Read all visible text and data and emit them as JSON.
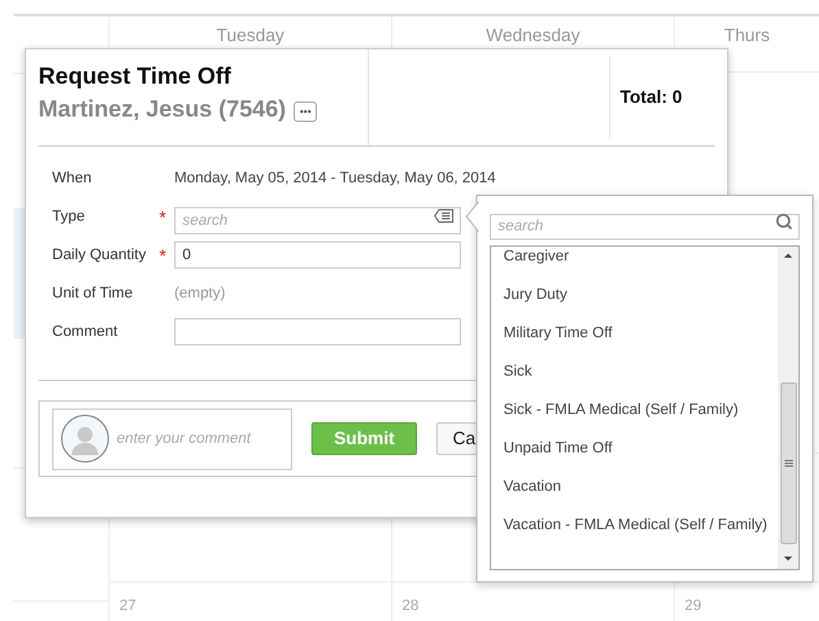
{
  "calendar": {
    "day_headers": [
      "Tuesday",
      "Wednesday",
      "Thurs"
    ],
    "date_numbers": [
      "27",
      "28",
      "29"
    ]
  },
  "dialog": {
    "title": "Request Time Off",
    "employee": "Martinez, Jesus (7546)",
    "more_button": "•••",
    "total": "Total: 0",
    "fields": [
      {
        "kind": "text",
        "label": "When",
        "required": false,
        "value": "Monday, May 05, 2014 - Tuesday, May 06, 2014"
      },
      {
        "kind": "picker",
        "label": "Type",
        "required": true,
        "placeholder": "search"
      },
      {
        "kind": "input",
        "label": "Daily Quantity",
        "required": true,
        "value": "0"
      },
      {
        "kind": "muted",
        "label": "Unit of Time",
        "required": false,
        "value": "(empty)"
      },
      {
        "kind": "input",
        "label": "Comment",
        "required": false
      }
    ],
    "required_mark": "*",
    "comment": {
      "placeholder": "enter your comment"
    },
    "buttons": [
      {
        "kind": "primary",
        "label": "Submit"
      },
      {
        "kind": "secondary",
        "label": "Ca"
      }
    ]
  },
  "type_dropdown": {
    "search": {
      "placeholder": "search"
    },
    "options": [
      {
        "label": "Caregiver"
      },
      {
        "label": "Jury Duty"
      },
      {
        "label": "Military Time Off"
      },
      {
        "label": "Sick"
      },
      {
        "label": "Sick - FMLA Medical (Self / Family)"
      },
      {
        "label": "Unpaid Time Off"
      },
      {
        "label": "Vacation"
      },
      {
        "label": "Vacation - FMLA Medical (Self / Family)"
      }
    ]
  }
}
